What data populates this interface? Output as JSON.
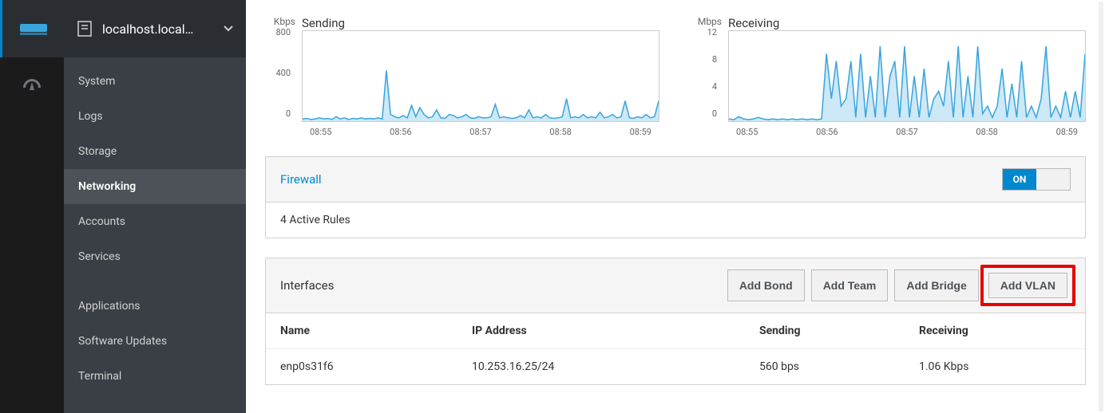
{
  "host": "localhost.local…",
  "sidebar": {
    "items": [
      {
        "label": "System"
      },
      {
        "label": "Logs"
      },
      {
        "label": "Storage"
      },
      {
        "label": "Networking",
        "active": true
      },
      {
        "label": "Accounts"
      },
      {
        "label": "Services"
      }
    ],
    "items2": [
      {
        "label": "Applications"
      },
      {
        "label": "Software Updates"
      },
      {
        "label": "Terminal"
      }
    ]
  },
  "charts": {
    "sending": {
      "unit": "Kbps",
      "title": "Sending",
      "y_ticks": [
        "800",
        "400",
        "0"
      ],
      "x_ticks": [
        "08:55",
        "08:56",
        "08:57",
        "08:58",
        "08:59"
      ]
    },
    "receiving": {
      "unit": "Mbps",
      "title": "Receiving",
      "y_ticks": [
        "12",
        "8",
        "4",
        "0"
      ],
      "x_ticks": [
        "08:55",
        "08:56",
        "08:57",
        "08:58",
        "08:59"
      ]
    }
  },
  "firewall": {
    "title": "Firewall",
    "toggle": "ON",
    "status": "4 Active Rules"
  },
  "interfaces": {
    "title": "Interfaces",
    "buttons": {
      "bond": "Add Bond",
      "team": "Add Team",
      "bridge": "Add Bridge",
      "vlan": "Add VLAN"
    },
    "columns": {
      "name": "Name",
      "ip": "IP Address",
      "sending": "Sending",
      "receiving": "Receiving"
    },
    "rows": [
      {
        "name": "enp0s31f6",
        "ip": "10.253.16.25/24",
        "sending": "560 bps",
        "receiving": "1.06 Kbps"
      }
    ]
  },
  "chart_data": [
    {
      "type": "line",
      "title": "Sending",
      "ylabel": "Kbps",
      "ylim": [
        0,
        800
      ],
      "x_ticks": [
        "08:55",
        "08:56",
        "08:57",
        "08:58",
        "08:59"
      ],
      "values_estimated": [
        20,
        25,
        15,
        20,
        30,
        20,
        25,
        15,
        40,
        20,
        30,
        15,
        25,
        20,
        30,
        20,
        25,
        20,
        30,
        20,
        450,
        60,
        40,
        30,
        50,
        30,
        140,
        40,
        120,
        60,
        30,
        40,
        100,
        30,
        25,
        60,
        50,
        30,
        40,
        60,
        30,
        25,
        40,
        30,
        30,
        40,
        150,
        30,
        40,
        30,
        25,
        30,
        50,
        30,
        100,
        30,
        40,
        30,
        60,
        30,
        25,
        30,
        40,
        200,
        30,
        40,
        30,
        60,
        30,
        40,
        30,
        80,
        30,
        40,
        60,
        30,
        40,
        180,
        30,
        25,
        40,
        30,
        60,
        30,
        40,
        180
      ]
    },
    {
      "type": "line",
      "title": "Receiving",
      "ylabel": "Mbps",
      "ylim": [
        0,
        12
      ],
      "x_ticks": [
        "08:55",
        "08:56",
        "08:57",
        "08:58",
        "08:59"
      ],
      "values_estimated": [
        0.3,
        0.2,
        0.6,
        0.3,
        0.2,
        0.3,
        0.5,
        0.3,
        0.2,
        0.3,
        0.2,
        0.3,
        0.2,
        0.3,
        0.2,
        0.3,
        0.2,
        0.3,
        0.2,
        0.3,
        9,
        3,
        8,
        2,
        3,
        8,
        0.5,
        9,
        0.5,
        6,
        0.5,
        10,
        0.5,
        6,
        8,
        0.5,
        10,
        0.5,
        6,
        0.5,
        7,
        0.5,
        3,
        4,
        2,
        8,
        0.5,
        10,
        0.5,
        6,
        0.5,
        10,
        1,
        2,
        0.5,
        2,
        7,
        0.5,
        5,
        0.5,
        8,
        0.5,
        2,
        0.5,
        3,
        10,
        0.5,
        2,
        0.5,
        4,
        0.5,
        4,
        0.5,
        9
      ]
    }
  ]
}
